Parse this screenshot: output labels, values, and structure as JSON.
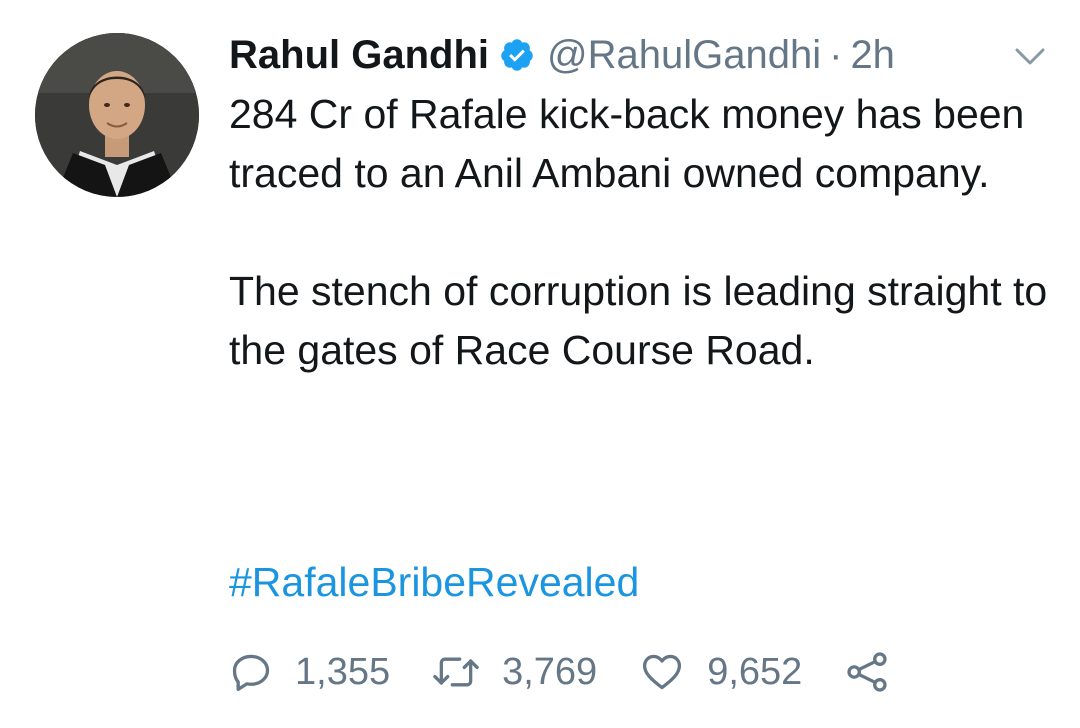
{
  "tweet": {
    "display_name": "Rahul Gandhi",
    "handle": "@RahulGandhi",
    "separator": "·",
    "time": "2h",
    "paragraph1": "284 Cr of Rafale kick-back money has been traced to an Anil Ambani owned company.",
    "paragraph2": "The stench of corruption is leading straight to the gates of Race Course Road.",
    "hashtag": "#RafaleBribeRevealed"
  },
  "actions": {
    "replies": "1,355",
    "retweets": "3,769",
    "likes": "9,652"
  },
  "icons": {
    "verified": "verified-badge-icon",
    "more": "chevron-down-icon",
    "reply": "reply-icon",
    "retweet": "retweet-icon",
    "like": "heart-icon",
    "share": "share-icon"
  },
  "colors": {
    "text": "#14171a",
    "muted": "#657786",
    "link": "#1b95e0",
    "verified": "#1da1f2"
  }
}
